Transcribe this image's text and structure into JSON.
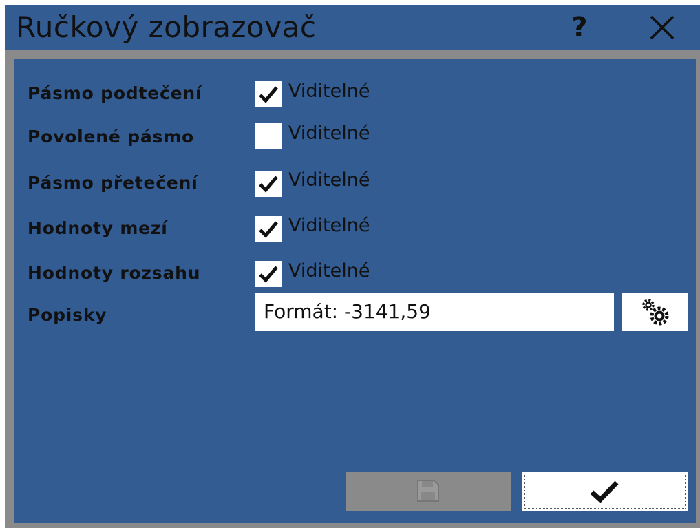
{
  "window": {
    "title": "Ručkový zobrazovač",
    "help_label": "?",
    "close_icon": "close-icon"
  },
  "options": [
    {
      "label": "Pásmo podtečení",
      "checkbox_text": "Viditelné",
      "checked": true
    },
    {
      "label": "Povolené pásmo",
      "checkbox_text": "Viditelné",
      "checked": false
    },
    {
      "label": "Pásmo přetečení",
      "checkbox_text": "Viditelné",
      "checked": true
    },
    {
      "label": "Hodnoty mezí",
      "checkbox_text": "Viditelné",
      "checked": true
    },
    {
      "label": "Hodnoty rozsahu",
      "checkbox_text": "Viditelné",
      "checked": true
    }
  ],
  "labels_row": {
    "label": "Popisky",
    "format_value": "Formát: -3141,59",
    "settings_icon": "gears-icon"
  },
  "footer": {
    "save_icon": "save-icon",
    "save_enabled": false,
    "ok_icon": "checkmark-icon"
  },
  "colors": {
    "panel": "#335c93",
    "frame": "#8a8a8a",
    "text": "#111111",
    "field": "#ffffff"
  }
}
